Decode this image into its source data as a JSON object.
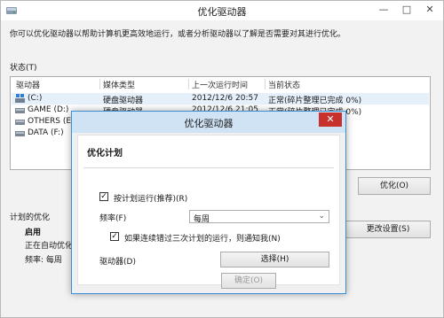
{
  "window": {
    "title": "优化驱动器",
    "minimize": "—",
    "maximize": "□",
    "close": "✕",
    "description": "你可以优化驱动器以帮助计算机更高效地运行，或者分析驱动器以了解是否需要对其进行优化。",
    "status_label": "状态(T)",
    "columns": [
      "驱动器",
      "媒体类型",
      "上一次运行时间",
      "当前状态"
    ],
    "drives": [
      {
        "name": "(C:)",
        "media": "硬盘驱动器",
        "last_run": "2012/12/6 20:57",
        "status": "正常(碎片整理已完成 0%)",
        "icon": "system-drive-icon"
      },
      {
        "name": "GAME (D:)",
        "media": "硬盘驱动器",
        "last_run": "2012/12/6 21:05",
        "status": "正常(碎片整理已完成 0%)",
        "icon": "hard-drive-icon"
      },
      {
        "name": "OTHERS (E:)",
        "media": "",
        "last_run": "",
        "status": "",
        "icon": "hard-drive-icon"
      },
      {
        "name": "DATA (F:)",
        "media": "",
        "last_run": "",
        "status": "",
        "icon": "hard-drive-icon"
      }
    ],
    "optimize_button": "优化(O)",
    "scheduled_label": "计划的优化",
    "scheduled_state": "启用",
    "scheduled_running": "正在自动优化驱",
    "scheduled_frequency": "频率: 每周",
    "change_settings_button": "更改设置(S)"
  },
  "dialog": {
    "title": "优化驱动器",
    "close": "✕",
    "heading": "优化计划",
    "schedule_checkbox": "按计划运行(推荐)(R)",
    "frequency_label": "频率(F)",
    "frequency_value": "每周",
    "notify_checkbox": "如果连续错过三次计划的运行，则通知我(N)",
    "drives_label": "驱动器(D)",
    "choose_button": "选择(H)",
    "ok_button": "确定(O)",
    "checkmark": "✓",
    "dropdown_arrow": "⌄"
  }
}
